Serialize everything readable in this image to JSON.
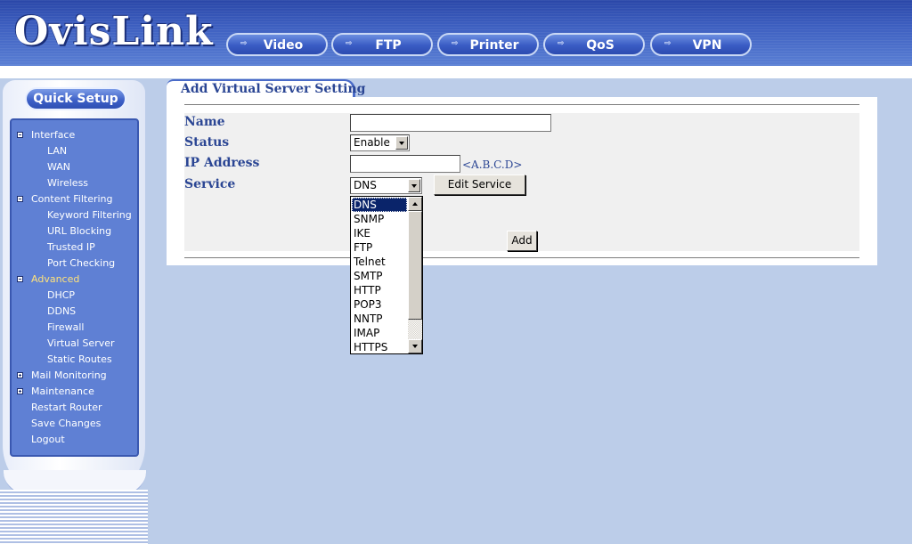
{
  "header": {
    "logo": "OvisLink",
    "nav": [
      {
        "label": "Video"
      },
      {
        "label": "FTP"
      },
      {
        "label": "Printer"
      },
      {
        "label": "QoS"
      },
      {
        "label": "VPN"
      }
    ],
    "arrow_glyph": "⇨"
  },
  "sidebar": {
    "quick_setup": "Quick Setup",
    "menu": [
      {
        "label": "Interface",
        "toggle": "minus"
      },
      {
        "label": "LAN"
      },
      {
        "label": "WAN"
      },
      {
        "label": "Wireless"
      },
      {
        "label": "Content Filtering",
        "toggle": "minus"
      },
      {
        "label": "Keyword Filtering"
      },
      {
        "label": "URL Blocking"
      },
      {
        "label": "Trusted IP"
      },
      {
        "label": "Port Checking"
      },
      {
        "label": "Advanced",
        "toggle": "minus",
        "highlight": true
      },
      {
        "label": "DHCP"
      },
      {
        "label": "DDNS"
      },
      {
        "label": "Firewall"
      },
      {
        "label": "Virtual Server"
      },
      {
        "label": "Static Routes"
      },
      {
        "label": "Mail Monitoring",
        "toggle": "plus"
      },
      {
        "label": "Maintenance",
        "toggle": "plus"
      },
      {
        "label": "Restart Router"
      },
      {
        "label": "Save Changes"
      },
      {
        "label": "Logout"
      }
    ]
  },
  "content": {
    "tab_title": "Add Virtual Server Setting",
    "form": {
      "name_label": "Name",
      "name_value": "",
      "status_label": "Status",
      "status_value": "Enable",
      "ip_label": "IP Address",
      "ip_value": "",
      "ip_hint": "<A.B.C.D>",
      "service_label": "Service",
      "service_value": "DNS",
      "edit_service_label": "Edit Service",
      "add_label": "Add"
    },
    "service_options": [
      "DNS",
      "SNMP",
      "IKE",
      "FTP",
      "Telnet",
      "SMTP",
      "HTTP",
      "POP3",
      "NNTP",
      "IMAP",
      "HTTPS"
    ],
    "selected_option": "DNS"
  },
  "colors": {
    "header_blue": "#3d5fc0",
    "label_blue": "#2b4694",
    "page_bg": "#bccde9",
    "menu_bg": "#5f80d4",
    "highlight_yellow": "#ffe27a",
    "selection_navy": "#0a246a"
  }
}
